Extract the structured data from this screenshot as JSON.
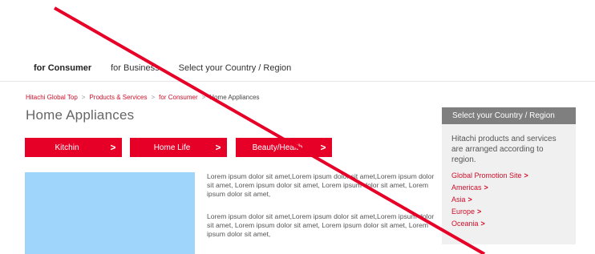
{
  "topnav": {
    "tabs": [
      "for Consumer",
      "for Business",
      "Select your Country / Region"
    ]
  },
  "breadcrumb": {
    "items": [
      "Hitachi Global Top",
      "Products & Services",
      "for Consumer",
      "Home Appliances"
    ],
    "separator": ">"
  },
  "page_title": "Home Appliances",
  "categories": [
    {
      "label": "Kitchin",
      "chevron": ">"
    },
    {
      "label": "Home Life",
      "chevron": ">"
    },
    {
      "label": "Beauty/Health",
      "chevron": ">"
    }
  ],
  "paragraphs": [
    "Lorem ipsum dolor sit amet,Lorem ipsum dolor sit amet,Lorem ipsum dolor sit amet, Lorem ipsum dolor sit amet, Lorem ipsum dolor sit amet, Lorem ipsum dolor sit amet,",
    "Lorem ipsum dolor sit amet,Lorem ipsum dolor sit amet,Lorem ipsum dolor sit amet, Lorem ipsum dolor sit amet, Lorem ipsum dolor sit amet, Lorem ipsum dolor sit amet,"
  ],
  "sidebar": {
    "title": "Select your Country / Region",
    "description": "Hitachi products and services are arranged according to region.",
    "links": [
      {
        "label": "Global Promotion Site",
        "arrow": ">"
      },
      {
        "label": "Americas",
        "arrow": ">"
      },
      {
        "label": "Asia",
        "arrow": ">"
      },
      {
        "label": "Europe",
        "arrow": ">"
      },
      {
        "label": "Oceania",
        "arrow": ">"
      }
    ]
  },
  "colors": {
    "accent_red": "#e60027",
    "link_red": "#cc0f2a",
    "image_placeholder": "#9fd5fa",
    "sidebar_header": "#7f7f7f",
    "sidebar_bg": "#f0f0f0"
  }
}
